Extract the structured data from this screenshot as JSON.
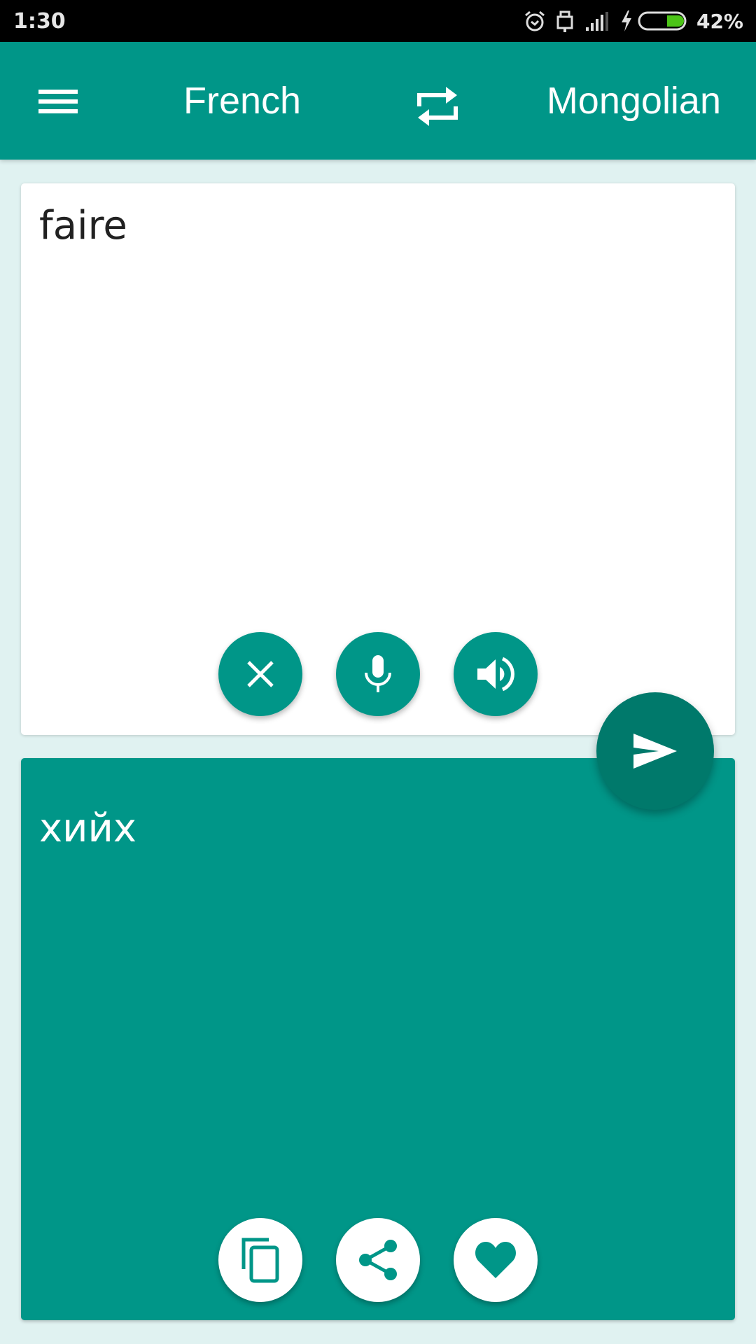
{
  "status_bar": {
    "time": "1:30",
    "battery_percent": "42%",
    "battery_level": 0.42,
    "icons": [
      "alarm-icon",
      "lock-icon",
      "signal-icon",
      "charging-icon",
      "battery-icon"
    ]
  },
  "app_bar": {
    "menu_icon": "menu-icon",
    "source_language": "French",
    "swap_icon": "swap-icon",
    "target_language": "Mongolian"
  },
  "input": {
    "text": "faire",
    "buttons": [
      {
        "name": "clear",
        "icon": "close-icon"
      },
      {
        "name": "voice-input",
        "icon": "microphone-icon"
      },
      {
        "name": "speak",
        "icon": "speaker-icon"
      }
    ]
  },
  "translate_button": {
    "icon": "send-icon"
  },
  "output": {
    "text": "хийх",
    "buttons": [
      {
        "name": "copy",
        "icon": "copy-icon"
      },
      {
        "name": "share",
        "icon": "share-icon"
      },
      {
        "name": "favorite",
        "icon": "heart-icon"
      }
    ]
  },
  "colors": {
    "primary": "#009688",
    "primary_dark": "#00796B",
    "background": "#E0F2F1",
    "battery_fill": "#4CC417"
  }
}
